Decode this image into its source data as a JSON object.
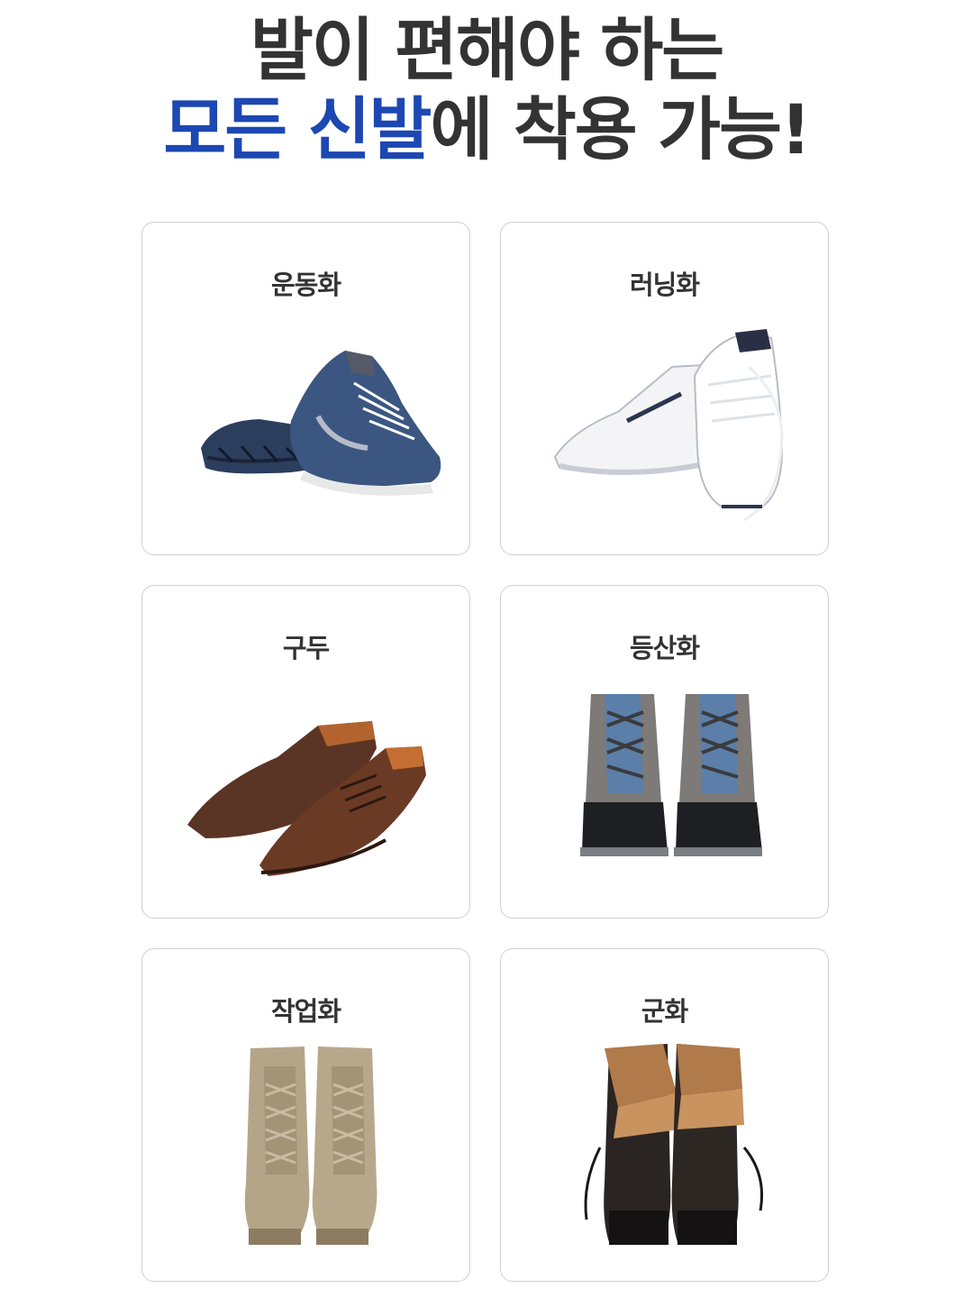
{
  "headline": {
    "line1": "발이 편해야 하는",
    "line2_highlight": "모든 신발",
    "line2_rest": "에 착용 가능!",
    "highlight_color": "#1d47b2",
    "text_color": "#333333"
  },
  "cards": [
    {
      "label": "운동화",
      "image": "navy-suede-sneakers-photo"
    },
    {
      "label": "러닝화",
      "image": "white-running-shoes-photo"
    },
    {
      "label": "구두",
      "image": "brown-leather-dress-shoes-photo"
    },
    {
      "label": "등산화",
      "image": "hiking-boots-photo"
    },
    {
      "label": "작업화",
      "image": "tan-work-boots-photo"
    },
    {
      "label": "군화",
      "image": "black-military-boots-photo"
    }
  ]
}
